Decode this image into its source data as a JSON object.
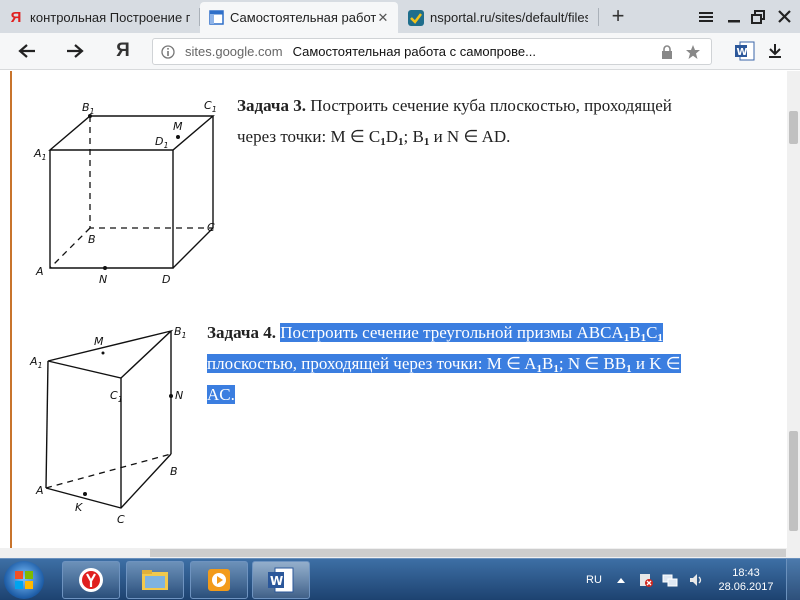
{
  "tabs": [
    {
      "title": "контрольная Построение п",
      "favicon": "yandex-icon"
    },
    {
      "title": "Самостоятельная работа",
      "favicon": "google-sites-icon",
      "active": true
    },
    {
      "title": "nsportal.ru/sites/default/files",
      "favicon": "nsportal-icon"
    }
  ],
  "address": {
    "host": "sites.google.com",
    "page_title": "Самостоятельная работа с самопрове..."
  },
  "task3": {
    "heading": "Задача 3.",
    "line1": "Построить сечение куба плоскостью, проходящей",
    "l2_a": "через точки: M ∈ C",
    "l2_s1": "1",
    "l2_b": "D",
    "l2_s2": "1",
    "l2_c": "; B",
    "l2_s3": "1",
    "l2_d": " и N ∈ AD."
  },
  "task4": {
    "heading": "Задача 4.",
    "l1_a": "Построить сечение треугольной призмы ABCA",
    "l1_s1": "1",
    "l1_b": "B",
    "l1_s2": "1",
    "l1_c": "C",
    "l1_s3": "1",
    "l2_a": "плоскостью, проходящей через точки: M ∈ A",
    "l2_s1": "1",
    "l2_b": "B",
    "l2_s2": "1",
    "l2_c": "; N ∈ BB",
    "l2_s3": "1",
    "l2_d": " и K ∈",
    "line3": "AC."
  },
  "cube_labels": {
    "B1": "B",
    "C1": "C",
    "A1": "A",
    "D1": "D",
    "M": "M",
    "B": "B",
    "C": "C",
    "A": "A",
    "N": "N",
    "D": "D",
    "sub": "1"
  },
  "prism_labels": {
    "M": "M",
    "B1": "B",
    "A1": "A",
    "C1": "C",
    "N": "N",
    "B": "B",
    "A": "A",
    "K": "K",
    "C": "C",
    "sub": "1"
  },
  "taskbar": {
    "lang": "RU",
    "time": "18:43",
    "date": "28.06.2017"
  },
  "colors": {
    "highlight": "#3b7ee0",
    "accent_line": "#c8742c"
  }
}
